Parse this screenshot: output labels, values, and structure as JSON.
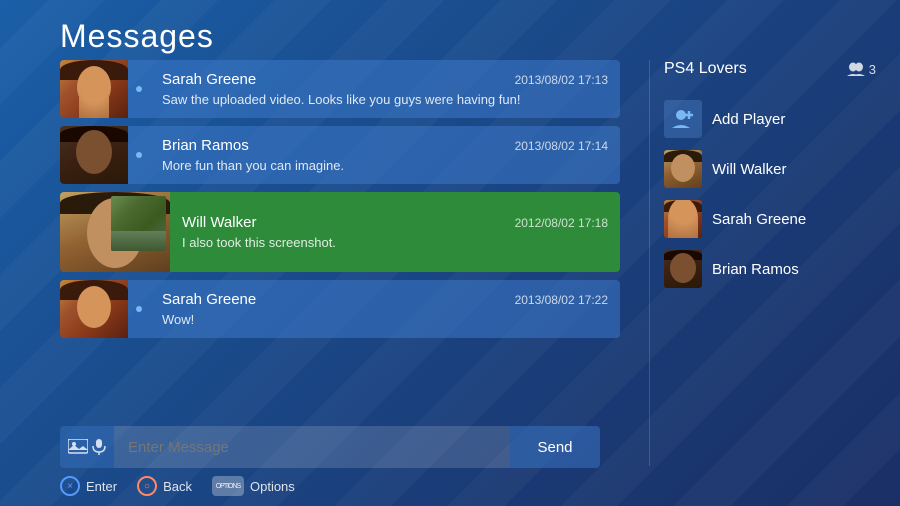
{
  "page": {
    "title": "Messages"
  },
  "messages": [
    {
      "id": 1,
      "sender": "Sarah Greene",
      "time": "2013/08/02 17:13",
      "text": "Saw the uploaded video. Looks like you guys were having fun!",
      "avatar": "sarah",
      "selected": false
    },
    {
      "id": 2,
      "sender": "Brian Ramos",
      "time": "2013/08/02 17:14",
      "text": "More fun than you can imagine.",
      "avatar": "brian",
      "selected": false
    },
    {
      "id": 3,
      "sender": "Will Walker",
      "time": "2012/08/02 17:18",
      "text": "I also took this screenshot.",
      "avatar": "will",
      "selected": true
    },
    {
      "id": 4,
      "sender": "Sarah Greene",
      "time": "2013/08/02 17:22",
      "text": "Wow!",
      "avatar": "sarah",
      "selected": false
    }
  ],
  "sidebar": {
    "group_name": "PS4 Lovers",
    "player_count": "3",
    "add_player_label": "Add Player",
    "members": [
      {
        "name": "Will Walker",
        "avatar": "will"
      },
      {
        "name": "Sarah Greene",
        "avatar": "sarah"
      },
      {
        "name": "Brian Ramos",
        "avatar": "brian"
      }
    ]
  },
  "input": {
    "placeholder": "Enter Message",
    "send_label": "Send"
  },
  "bottom_nav": [
    {
      "icon": "×",
      "label": "Enter",
      "type": "x"
    },
    {
      "icon": "○",
      "label": "Back",
      "type": "circle"
    },
    {
      "icon": "OPTIONS",
      "label": "Options",
      "type": "options"
    }
  ]
}
